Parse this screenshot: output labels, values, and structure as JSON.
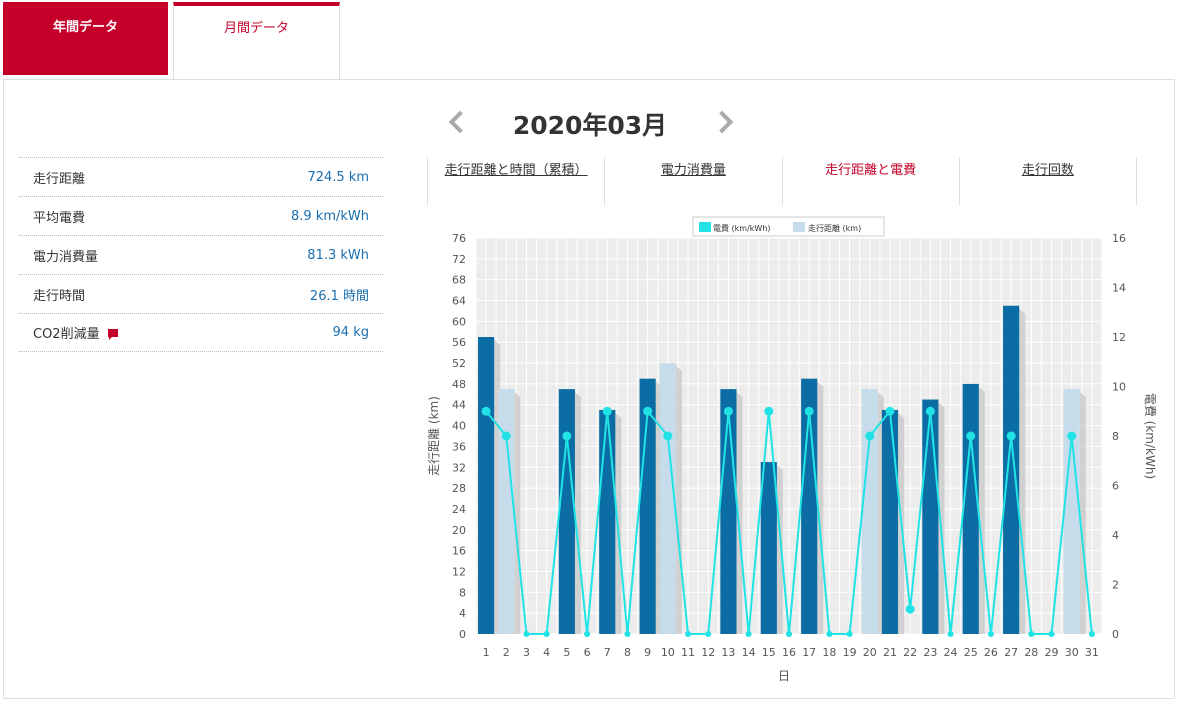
{
  "tabs": {
    "annual": "年間データ",
    "monthly": "月間データ"
  },
  "month_title": "2020年03月",
  "stats": [
    {
      "label": "走行距離",
      "value": "724.5 km"
    },
    {
      "label": "平均電費",
      "value": "8.9 km/kWh"
    },
    {
      "label": "電力消費量",
      "value": "81.3 kWh"
    },
    {
      "label": "走行時間",
      "value": "26.1 時間"
    },
    {
      "label": "CO2削減量",
      "value": "94 kg"
    }
  ],
  "chart_tabs": [
    "走行距離と時間（累積）",
    "電力消費量",
    "走行距離と電費",
    "走行回数"
  ],
  "colors": {
    "accent": "#c4002a",
    "bar_dark": "#0b6da3",
    "bar_light": "#c7dceb",
    "line": "#21e3e6",
    "plot_bg": "#ececec",
    "value_text": "#1a6fb0"
  },
  "icons": {
    "prev": "chevron-left-icon",
    "next": "chevron-right-icon",
    "co2": "flag-icon"
  },
  "chart_data": {
    "type": "bar",
    "xlabel": "日",
    "ylabel": "走行距離 (km)",
    "y2label": "電費 (km/kWh)",
    "ylim": [
      0,
      76
    ],
    "y2lim": [
      0,
      16
    ],
    "yticks": [
      0,
      4,
      8,
      12,
      16,
      20,
      24,
      28,
      32,
      36,
      40,
      44,
      48,
      52,
      56,
      60,
      64,
      68,
      72,
      76
    ],
    "y2ticks": [
      0,
      2,
      4,
      6,
      8,
      10,
      12,
      14,
      16
    ],
    "categories": [
      "1",
      "2",
      "3",
      "4",
      "5",
      "6",
      "7",
      "8",
      "9",
      "10",
      "11",
      "12",
      "13",
      "14",
      "15",
      "16",
      "17",
      "18",
      "19",
      "20",
      "21",
      "22",
      "23",
      "24",
      "25",
      "26",
      "27",
      "28",
      "29",
      "30",
      "31"
    ],
    "legend_position": "top",
    "legend": [
      "電費 (km/kWh)",
      "走行距離 (km)"
    ],
    "series": [
      {
        "name": "走行距離 (km)",
        "type": "bar",
        "values": [
          57,
          47,
          0,
          0,
          47,
          0,
          43,
          0,
          49,
          52,
          0,
          0,
          47,
          0,
          33,
          0,
          49,
          0,
          0,
          47,
          43,
          0,
          45,
          0,
          48,
          0,
          63,
          0,
          0,
          47,
          0
        ],
        "shade": [
          "dark",
          "light",
          "dark",
          "dark",
          "dark",
          "dark",
          "dark",
          "dark",
          "dark",
          "light",
          "dark",
          "dark",
          "dark",
          "dark",
          "dark",
          "dark",
          "dark",
          "dark",
          "dark",
          "light",
          "dark",
          "dark",
          "dark",
          "dark",
          "dark",
          "dark",
          "dark",
          "dark",
          "dark",
          "light",
          "dark"
        ]
      },
      {
        "name": "電費 (km/kWh)",
        "type": "line",
        "axis": "right",
        "values": [
          9,
          8,
          0,
          0,
          8,
          0,
          9,
          0,
          9,
          8,
          0,
          0,
          9,
          0,
          9,
          0,
          9,
          0,
          0,
          8,
          9,
          1,
          9,
          0,
          8,
          0,
          8,
          0,
          0,
          8,
          0
        ]
      }
    ],
    "grid": true
  }
}
